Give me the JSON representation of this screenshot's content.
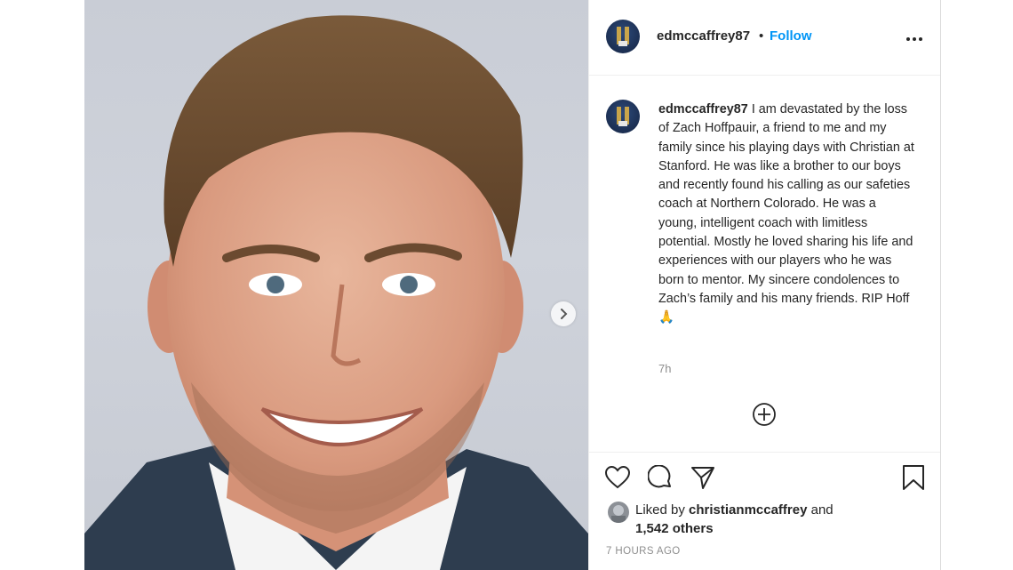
{
  "post": {
    "username": "edmccaffrey87",
    "separator": "•",
    "follow_label": "Follow",
    "more_icon": "more-options-icon"
  },
  "caption": {
    "username": "edmccaffrey87",
    "text": "I am devastated by the loss of Zach Hoffpauir, a friend to me and my family since his playing days with Christian at Stanford. He was like a brother to our boys and recently found his calling as our safeties coach at Northern Colorado. He was a young, intelligent coach with limitless potential. Mostly he loved sharing his life and experiences with our players who he was born to mentor. My sincere condolences to Zach’s family and his many friends. RIP Hoff 🙏",
    "time": "7h"
  },
  "actions": {
    "like_icon": "heart-icon",
    "comment_icon": "comment-icon",
    "share_icon": "share-icon",
    "save_icon": "bookmark-icon",
    "load_more_icon": "plus-circle-icon"
  },
  "likes": {
    "prefix": "Liked by",
    "liker": "christianmccaffrey",
    "conjunction": "and",
    "others": "1,542 others"
  },
  "posted_time": "7 HOURS AGO",
  "colors": {
    "link_blue": "#0095f6",
    "text_primary": "#262626",
    "text_secondary": "#8e8e8e",
    "border": "#efefef"
  }
}
